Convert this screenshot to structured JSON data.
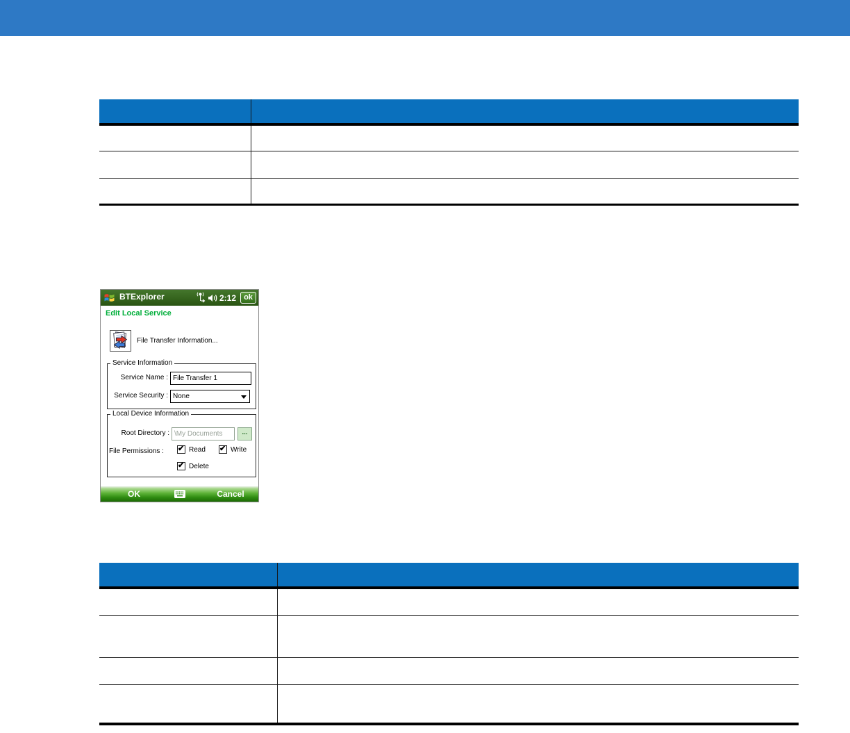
{
  "colors": {
    "banner_blue": "#2e79c5",
    "table_header_blue": "#0a70bd",
    "heading_green": "#00ae3a",
    "titlebar_green": "#35641d"
  },
  "icons": {
    "check": "✔"
  },
  "table_top": {
    "header": [
      "",
      ""
    ],
    "rows": [
      [
        "",
        ""
      ],
      [
        "",
        ""
      ],
      [
        "",
        ""
      ]
    ]
  },
  "table_bottom": {
    "header": [
      "",
      ""
    ],
    "rows": [
      [
        "",
        ""
      ],
      [
        "",
        ""
      ],
      [
        "",
        ""
      ],
      [
        "",
        ""
      ]
    ]
  },
  "device": {
    "titlebar": {
      "app_name": "BTExplorer",
      "time": "2:12",
      "ok_label": "ok"
    },
    "dialog": {
      "heading": "Edit Local Service",
      "service_type_label": "File Transfer Information...",
      "service_information": {
        "legend": "Service Information",
        "service_name_label": "Service Name :",
        "service_name_value": "File Transfer 1",
        "service_security_label": "Service Security :",
        "service_security_value": "None"
      },
      "local_device_information": {
        "legend": "Local Device Information",
        "root_directory_label": "Root Directory :",
        "root_directory_value": "\\My Documents",
        "browse_button_label": "...",
        "file_permissions_label": "File Permissions :",
        "permissions": [
          {
            "label": "Read",
            "checked": true
          },
          {
            "label": "Write",
            "checked": true
          },
          {
            "label": "Delete",
            "checked": true
          }
        ]
      }
    },
    "bottombar": {
      "ok_label": "OK",
      "cancel_label": "Cancel"
    }
  }
}
